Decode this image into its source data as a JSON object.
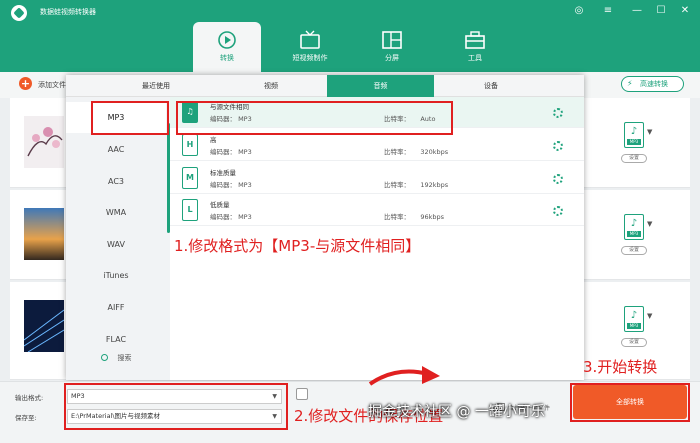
{
  "app": {
    "title": "数据蛙视频转换器"
  },
  "window_controls": [
    "◎",
    "≡",
    "—",
    "☐",
    "✕"
  ],
  "nav": [
    {
      "label": "转换",
      "icon": "convert-icon",
      "active": true
    },
    {
      "label": "短视频制作",
      "icon": "tv-icon",
      "active": false
    },
    {
      "label": "分屏",
      "icon": "split-screen-icon",
      "active": false
    },
    {
      "label": "工具",
      "icon": "toolbox-icon",
      "active": false
    }
  ],
  "toolbar": {
    "add_label": "添加文件",
    "add_symbol": "+",
    "speed_label": "高速转换"
  },
  "popup": {
    "tabs": [
      {
        "label": "最近使用",
        "active": false
      },
      {
        "label": "视频",
        "active": false
      },
      {
        "label": "音频",
        "active": true
      },
      {
        "label": "设备",
        "active": false
      }
    ],
    "formats": [
      {
        "label": "MP3",
        "selected": true
      },
      {
        "label": "AAC"
      },
      {
        "label": "AC3"
      },
      {
        "label": "WMA"
      },
      {
        "label": "WAV"
      },
      {
        "label": "iTunes"
      },
      {
        "label": "AIFF"
      },
      {
        "label": "FLAC"
      }
    ],
    "search_label": "搜索",
    "qualities": [
      {
        "name": "与源文件相同",
        "encoder": "编码器： MP3",
        "bitrate_label": "比特率：",
        "bitrate": "Auto",
        "icon_char": "♫",
        "selected": true
      },
      {
        "name": "高",
        "encoder": "编码器： MP3",
        "bitrate_label": "比特率：",
        "bitrate": "320kbps",
        "icon_char": "H"
      },
      {
        "name": "标准质量",
        "encoder": "编码器： MP3",
        "bitrate_label": "比特率：",
        "bitrate": "192kbps",
        "icon_char": "M"
      },
      {
        "name": "低质量",
        "encoder": "编码器： MP3",
        "bitrate_label": "比特率：",
        "bitrate": "96kbps",
        "icon_char": "L"
      }
    ]
  },
  "file_rows": [
    {
      "format_tag": "MP3",
      "settings_label": "设置"
    },
    {
      "format_tag": "MP3",
      "settings_label": "设置"
    },
    {
      "format_tag": "MP3",
      "settings_label": "设置"
    }
  ],
  "bottom": {
    "output_label": "输出格式:",
    "output_value": "MP3",
    "save_label": "保存至:",
    "save_value": "E:\\PrMaterial\\图片与视频素材",
    "merge_label": "合并成一个文件",
    "start_label": "全部转换"
  },
  "annotations": {
    "step1": "1.修改格式为【MP3-与源文件相同】",
    "step2": "2.修改文件的保存位置",
    "step3": "3.开始转换"
  },
  "watermark": "掘金技术社区 @ 一罐小可乐",
  "colors": {
    "brand": "#1ea27c",
    "accent": "#f05a28",
    "highlight": "#e02020"
  }
}
